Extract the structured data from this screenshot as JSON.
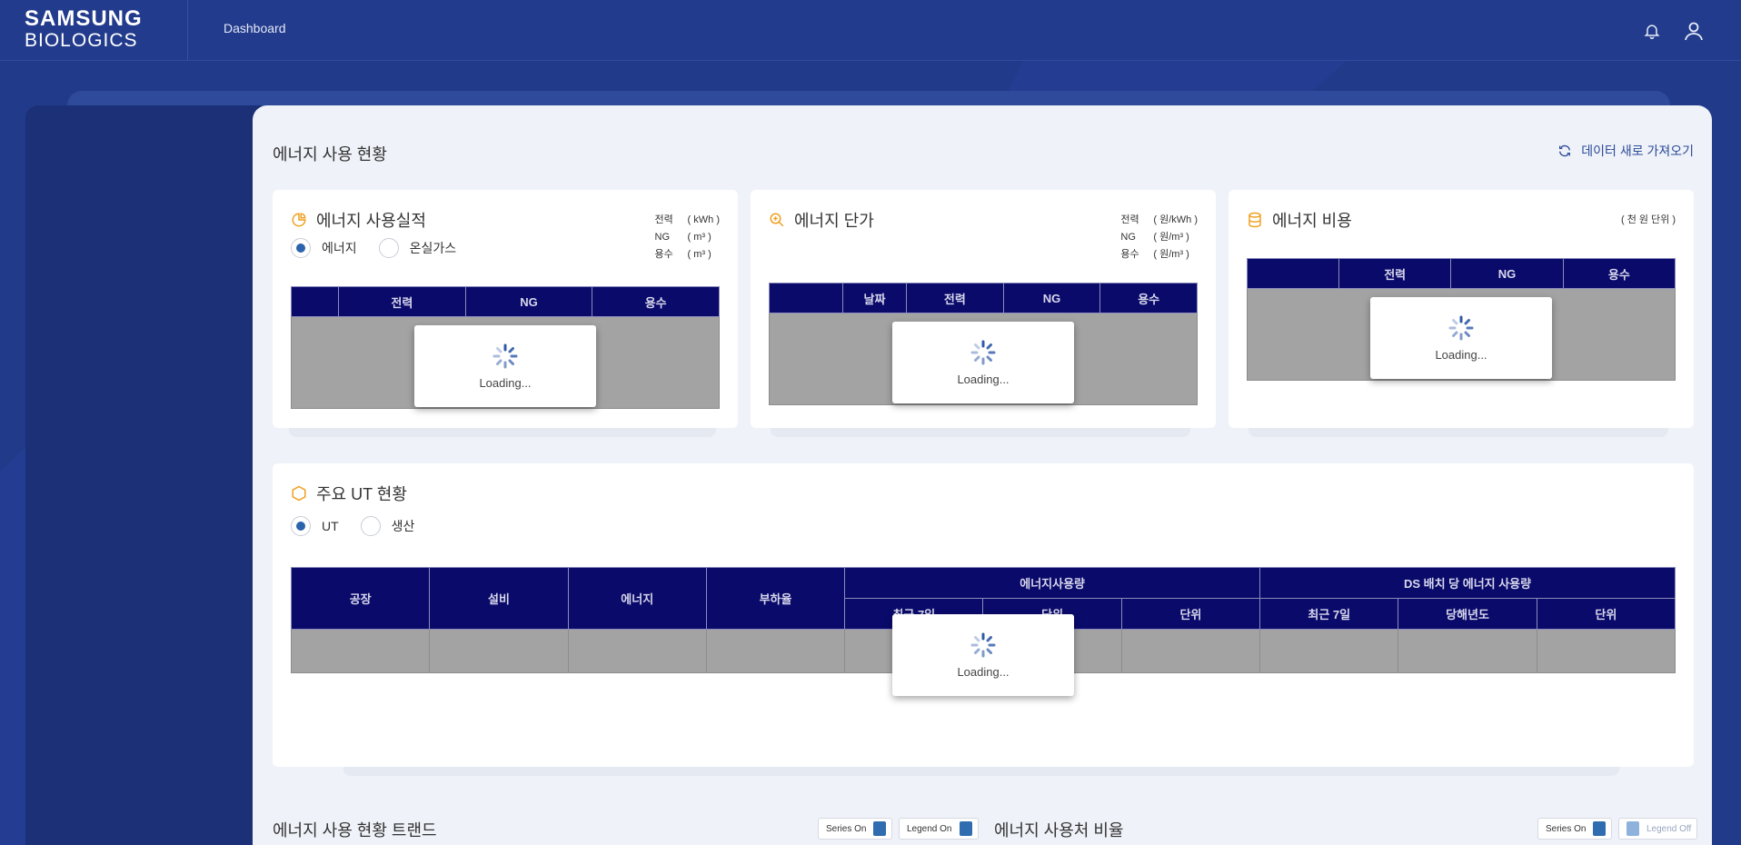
{
  "header": {
    "brand_line1": "SAMSUNG",
    "brand_line2": "BIOLOGICS",
    "nav_item": "Dashboard",
    "icons": [
      "bell-icon",
      "user-icon"
    ]
  },
  "main": {
    "section_title": "에너지 사용 현황",
    "refresh_label": "데이터 새로 가져오기"
  },
  "cards": {
    "usage": {
      "title": "에너지 사용실적",
      "icon": "pie-chart-icon",
      "units": [
        {
          "k": "전력",
          "v": "( kWh )"
        },
        {
          "k": "NG",
          "v": "( m³ )"
        },
        {
          "k": "용수",
          "v": "( m³ )"
        }
      ],
      "radios": [
        {
          "label": "에너지",
          "selected": true
        },
        {
          "label": "온실가스",
          "selected": false
        }
      ],
      "columns": [
        "",
        "전력",
        "NG",
        "용수"
      ],
      "loading": "Loading..."
    },
    "price": {
      "title": "에너지 단가",
      "icon": "zoom-in-icon",
      "units": [
        {
          "k": "전력",
          "v": "( 원/kWh )"
        },
        {
          "k": "NG",
          "v": "( 원/m³ )"
        },
        {
          "k": "용수",
          "v": "( 원/m³ )"
        }
      ],
      "columns": [
        "",
        "날짜",
        "전력",
        "NG",
        "용수"
      ],
      "loading": "Loading..."
    },
    "cost": {
      "title": "에너지 비용",
      "icon": "database-icon",
      "unit_note": "( 천 원 단위 )",
      "columns": [
        "",
        "전력",
        "NG",
        "용수"
      ],
      "loading": "Loading..."
    }
  },
  "ut": {
    "title": "주요 UT 현황",
    "icon": "hexagon-icon",
    "radios": [
      {
        "label": "UT",
        "selected": true
      },
      {
        "label": "생산",
        "selected": false
      }
    ],
    "columns": [
      "공장",
      "설비",
      "에너지",
      "부하율"
    ],
    "group1": "에너지사용량",
    "group1_cols": [
      "최근 7일",
      "단위",
      "단위"
    ],
    "group2": "DS 배치 당 에너지 사용량",
    "group2_cols": [
      "최근 7일",
      "당해년도",
      "단위"
    ],
    "loading": "Loading..."
  },
  "bottom": {
    "trend_title": "에너지 사용 현황 트랜드",
    "ratio_title": "에너지 사용처 비율",
    "series_on": "Series On",
    "legend_on": "Legend On",
    "legend_off": "Legend Off"
  },
  "colors": {
    "background": "#213a8a",
    "table_header": "#0a0a6b",
    "accent_icon": "#f0a020",
    "loading_spinner": "#2f5aa8"
  }
}
